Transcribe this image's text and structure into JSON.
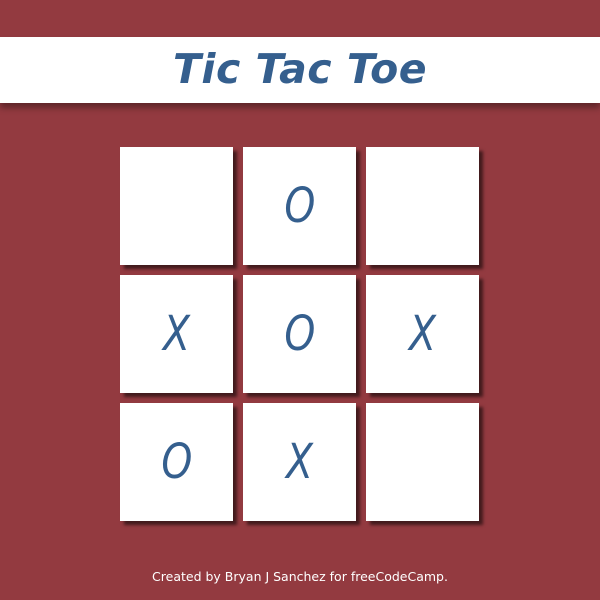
{
  "header": {
    "title": "Tic Tac Toe"
  },
  "board": {
    "cells": [
      {
        "mark": ""
      },
      {
        "mark": "O"
      },
      {
        "mark": ""
      },
      {
        "mark": "X"
      },
      {
        "mark": "O"
      },
      {
        "mark": "X"
      },
      {
        "mark": "O"
      },
      {
        "mark": "X"
      },
      {
        "mark": ""
      }
    ]
  },
  "footer": {
    "credit": "Created by Bryan J Sanchez for freeCodeCamp."
  },
  "colors": {
    "background": "#933a40",
    "accent": "#355f8e",
    "cell": "#ffffff"
  }
}
